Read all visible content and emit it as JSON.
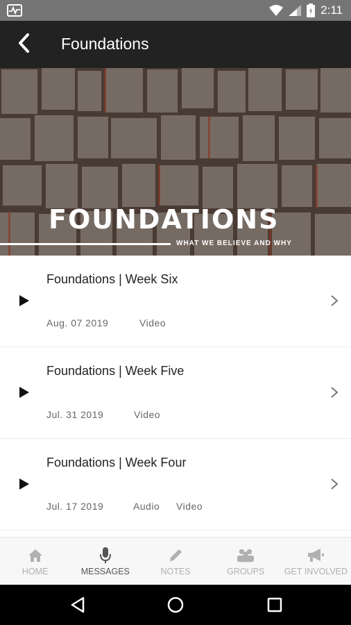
{
  "status_bar": {
    "time": "2:11",
    "icons": [
      "activity-icon",
      "wifi-icon",
      "signal-icon",
      "battery-icon"
    ]
  },
  "app_bar": {
    "title": "Foundations",
    "back_icon": "chevron-left-icon"
  },
  "banner": {
    "title": "FOUNDATIONS",
    "subtitle": "WHAT WE BELIEVE AND WHY"
  },
  "messages": [
    {
      "title": "Foundations | Week Six",
      "date": "Aug. 07 2019",
      "media": [
        "Video"
      ]
    },
    {
      "title": "Foundations | Week Five",
      "date": "Jul. 31 2019",
      "media": [
        "Video"
      ]
    },
    {
      "title": "Foundations | Week Four",
      "date": "Jul. 17 2019",
      "media": [
        "Audio",
        "Video"
      ]
    }
  ],
  "bottom_nav": {
    "items": [
      {
        "label": "HOME",
        "icon": "home-icon",
        "active": false
      },
      {
        "label": "MESSAGES",
        "icon": "microphone-icon",
        "active": true
      },
      {
        "label": "NOTES",
        "icon": "pencil-icon",
        "active": false
      },
      {
        "label": "GROUPS",
        "icon": "group-icon",
        "active": false
      },
      {
        "label": "GET INVOLVED",
        "icon": "megaphone-icon",
        "active": false
      }
    ]
  },
  "colors": {
    "app_bar": "#222222",
    "status_bar": "#757575",
    "nav_active": "#555555",
    "nav_inactive": "#b0b0b0"
  }
}
